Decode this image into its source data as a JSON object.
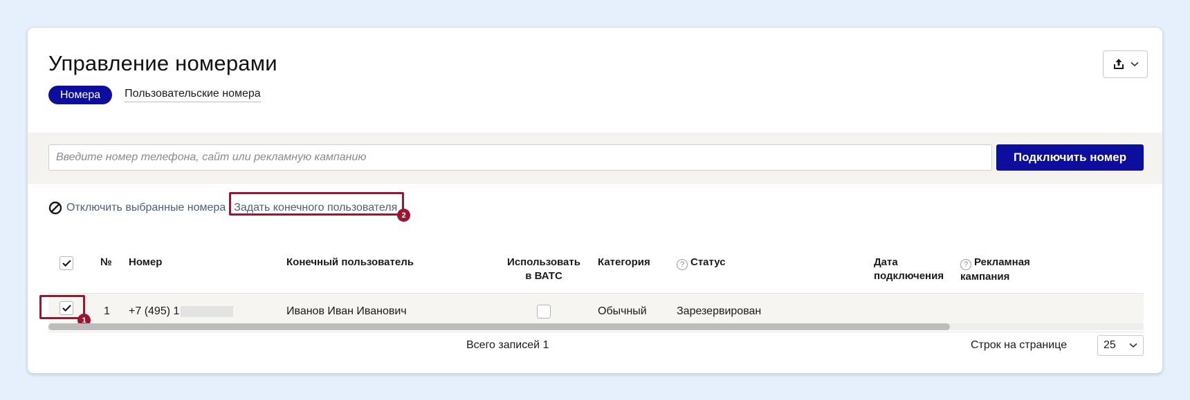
{
  "page": {
    "title": "Управление номерами",
    "tabs": [
      {
        "label": "Номера",
        "active": true
      },
      {
        "label": "Пользовательские номера",
        "active": false
      }
    ]
  },
  "toolbar": {
    "export_icon": "export-icon",
    "dropdown_icon": "chevron-down-icon"
  },
  "search": {
    "placeholder": "Введите номер телефона, сайт или рекламную кампанию",
    "value": "",
    "connect_label": "Подключить номер"
  },
  "actions": {
    "disable_label": "Отключить выбранные номера",
    "assign_label": "Задать конечного пользователя"
  },
  "annotations": {
    "badge_1": "1",
    "badge_2": "2",
    "highlight_color": "#9c1530"
  },
  "table": {
    "columns": {
      "num": "№",
      "number": "Номер",
      "end_user": "Конечный пользователь",
      "use_vats_line1": "Использовать",
      "use_vats_line2": "в ВАТС",
      "category": "Категория",
      "status": "Статус",
      "date_line1": "Дата",
      "date_line2": "подключения",
      "campaign_line1": "Рекламная",
      "campaign_line2": "кампания"
    },
    "header_checked": true,
    "rows": [
      {
        "checked": true,
        "num": "1",
        "number": "+7 (495) 1",
        "end_user": "Иванов Иван Иванович",
        "use_vats": false,
        "category": "Обычный",
        "status": "Зарезервирован",
        "date": "",
        "campaign": ""
      }
    ]
  },
  "footer": {
    "total": "Всего записей 1",
    "rows_per_page_label": "Строк на странице",
    "rows_per_page_value": "25"
  },
  "colors": {
    "brand": "#0d0e9e",
    "background": "#e5f0fc",
    "link": "#4a5f7e",
    "annotation": "#9c1530"
  }
}
